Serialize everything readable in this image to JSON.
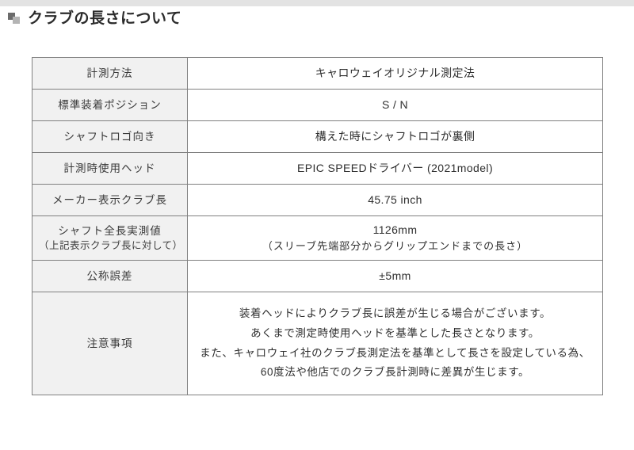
{
  "page": {
    "heading": "クラブの長さについて",
    "heading_icon": "double-square-icon",
    "accent_color": "#6b6b6b",
    "border_color": "#808080",
    "label_bg_color": "#f1f1f1",
    "top_strip_color": "#e3e3e3"
  },
  "table": {
    "name": "club-length-spec-table",
    "rows": [
      {
        "label": "計測方法",
        "value": "キャロウェイオリジナル測定法"
      },
      {
        "label": "標準装着ポジション",
        "value": "S / N"
      },
      {
        "label": "シャフトロゴ向き",
        "value": "構えた時にシャフトロゴが裏側"
      },
      {
        "label": "計測時使用ヘッド",
        "value": "EPIC SPEEDドライバー (2021model)"
      },
      {
        "label": "メーカー表示クラブ長",
        "value": "45.75 inch"
      },
      {
        "label": "シャフト全長実測値",
        "label_sub": "（上記表示クラブ長に対して）",
        "value": "1126mm",
        "value_sub": "（スリーブ先端部分からグリップエンドまでの長さ）"
      },
      {
        "label": "公称誤差",
        "value": "±5mm"
      },
      {
        "label": "注意事項",
        "note_lines": [
          "装着ヘッドによりクラブ長に誤差が生じる場合がございます。",
          "あくまで測定時使用ヘッドを基準とした長さとなります。",
          "また、キャロウェイ社のクラブ長測定法を基準として長さを設定している為、",
          "60度法や他店でのクラブ長計測時に差異が生じます。"
        ]
      }
    ]
  }
}
